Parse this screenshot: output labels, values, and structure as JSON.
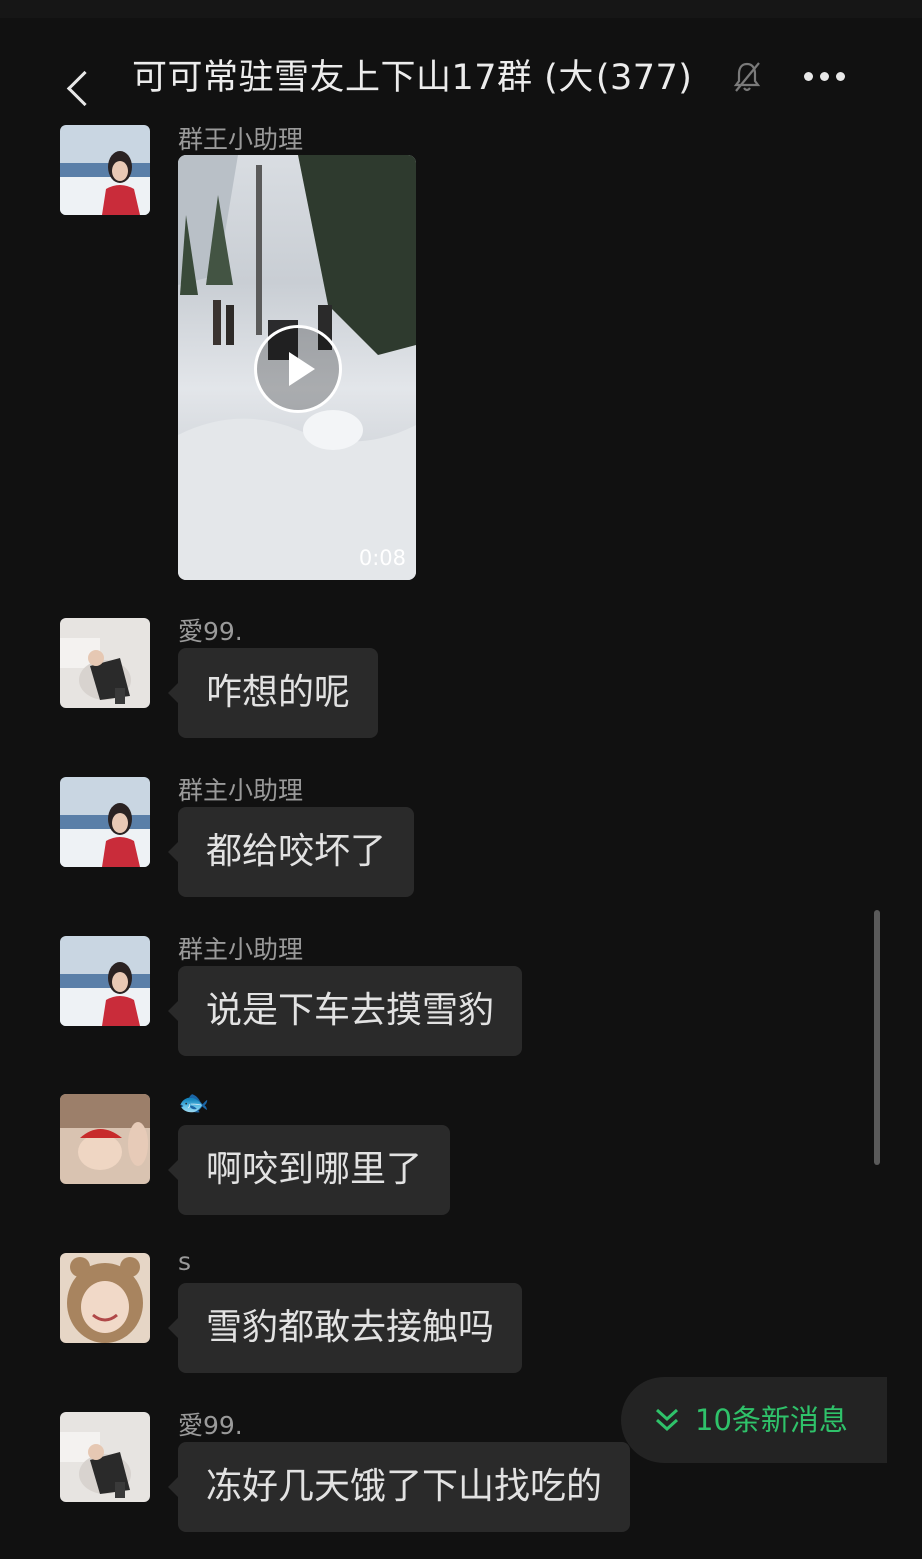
{
  "header": {
    "back_icon": "chevron-left-icon",
    "title": "可可常驻雪友上下山17群 (大",
    "member_count": "(377)",
    "mute_icon": "bell-off-icon",
    "more_icon": "more-dots-icon"
  },
  "messages": [
    {
      "sender": "群王小助理",
      "type": "video",
      "duration": "0:08"
    },
    {
      "sender": "愛99.",
      "text": "咋想的呢"
    },
    {
      "sender": "群主小助理",
      "text": "都给咬坏了"
    },
    {
      "sender": "群主小助理",
      "text": "说是下车去摸雪豹"
    },
    {
      "sender": "🐟",
      "text": "啊咬到哪里了"
    },
    {
      "sender": "s",
      "text": "雪豹都敢去接触吗"
    },
    {
      "sender": "愛99.",
      "text": "冻好几天饿了下山找吃的"
    }
  ],
  "new_messages": {
    "label": "10条新消息",
    "accent": "#2fc26a"
  },
  "colors": {
    "background": "#111111",
    "bubble": "#2a2a2a",
    "sender_name": "#9a9a9a"
  }
}
